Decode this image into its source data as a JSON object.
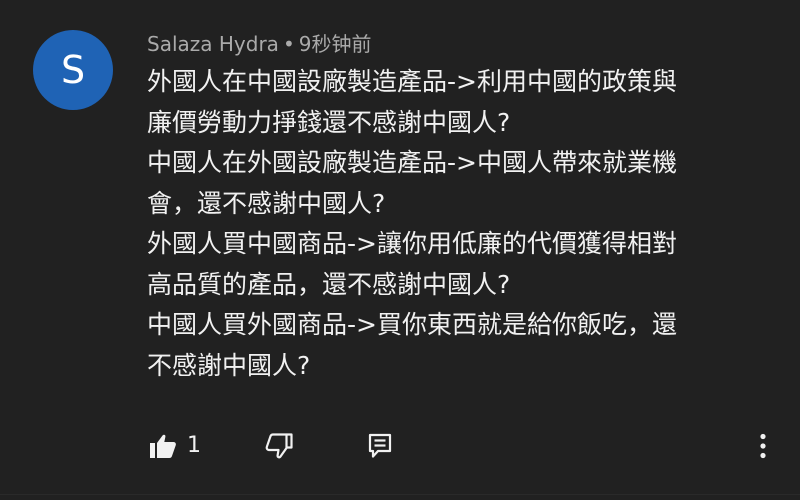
{
  "comment": {
    "avatar_letter": "S",
    "avatar_color": "#1f63b5",
    "author": "Salaza Hydra",
    "separator": "•",
    "time": "9秒钟前",
    "lines": [
      "外國人在中國設廠製造產品->利用中國的政策與",
      "廉價勞動力掙錢還不感謝中國人?",
      "中國人在外國設廠製造產品->中國人帶來就業機",
      "會，還不感謝中國人?",
      "外國人買中國商品->讓你用低廉的代價獲得相對",
      "高品質的產品，還不感謝中國人?",
      "中國人買外國商品->買你東西就是給你飯吃，還",
      "不感謝中國人?"
    ]
  },
  "actions": {
    "like_icon": "thumb-up-icon",
    "like_count": "1",
    "dislike_icon": "thumb-down-icon",
    "reply_icon": "reply-icon",
    "more_icon": "more-vert-icon"
  },
  "colors": {
    "background": "#212121",
    "text_primary": "#f1f1f1",
    "text_secondary": "#aaaaaa"
  }
}
